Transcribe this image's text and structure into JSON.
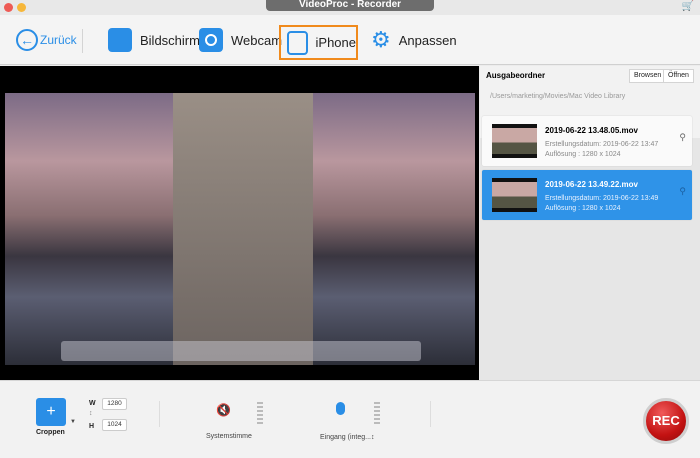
{
  "window": {
    "title": "VideoProc - Recorder"
  },
  "toolbar": {
    "back": "Zurück",
    "screen": "Bildschirm",
    "webcam": "Webcam",
    "iphone": "iPhone",
    "customize": "Anpassen",
    "accent": "#f08a1c"
  },
  "output": {
    "label": "Ausgabeordner",
    "browse": "Browsen",
    "open": "Öffnen",
    "path": "/Users/marketing/Movies/Mac Video Library"
  },
  "files": [
    {
      "name": "2019-06-22 13.48.05.mov",
      "created": "Erstellungsdatum: 2019-06-22 13:47",
      "resolution": "Auflösung : 1280 x 1024",
      "selected": false
    },
    {
      "name": "2019-06-22 13.49.22.mov",
      "created": "Erstellungsdatum: 2019-06-22 13:49",
      "resolution": "Auflösung : 1280 x 1024",
      "selected": true
    }
  ],
  "controls": {
    "crop": "Croppen",
    "w_label": "W",
    "h_label": "H",
    "width": "1280",
    "height": "1024",
    "system_audio": "Systemstimme",
    "input": "Eingang (integ...↕",
    "rec": "REC"
  }
}
